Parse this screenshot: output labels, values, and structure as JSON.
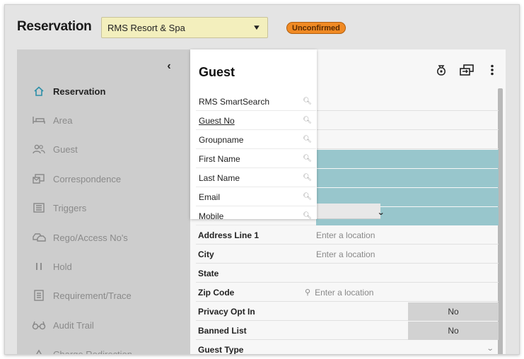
{
  "header": {
    "title": "Reservation",
    "property": "RMS Resort & Spa",
    "status": "Unconfirmed"
  },
  "sidebar": {
    "items": [
      {
        "label": "Reservation",
        "icon": "home-icon",
        "active": true
      },
      {
        "label": "Area",
        "icon": "bed-icon",
        "active": false
      },
      {
        "label": "Guest",
        "icon": "people-icon",
        "active": false
      },
      {
        "label": "Correspondence",
        "icon": "mail-icon",
        "active": false
      },
      {
        "label": "Triggers",
        "icon": "list-icon",
        "active": false
      },
      {
        "label": "Rego/Access No's",
        "icon": "car-icon",
        "active": false
      },
      {
        "label": "Hold",
        "icon": "pause-icon",
        "active": false
      },
      {
        "label": "Requirement/Trace",
        "icon": "note-icon",
        "active": false
      },
      {
        "label": "Audit Trail",
        "icon": "glasses-icon",
        "active": false
      },
      {
        "label": "Charge Redirection",
        "icon": "redirect-icon",
        "active": false
      }
    ]
  },
  "guest_popover": {
    "title": "Guest",
    "items": [
      {
        "label": "RMS SmartSearch"
      },
      {
        "label": "Guest No"
      },
      {
        "label": "Groupname"
      },
      {
        "label": "First Name"
      },
      {
        "label": "Last Name"
      },
      {
        "label": "Email"
      },
      {
        "label": "Mobile"
      }
    ]
  },
  "form": {
    "address_line_1": {
      "label": "Address Line 1",
      "placeholder": "Enter a location"
    },
    "city": {
      "label": "City",
      "placeholder": "Enter a location"
    },
    "state": {
      "label": "State"
    },
    "zip": {
      "label": "Zip Code",
      "placeholder": "Enter a location"
    },
    "privacy": {
      "label": "Privacy Opt In",
      "value": "No"
    },
    "banned": {
      "label": "Banned List",
      "value": "No"
    },
    "guest_type": {
      "label": "Guest Type"
    }
  },
  "colors": {
    "status_badge": "#f08a24",
    "property_select": "#f3efbd",
    "teal_fields": "#98c6cc",
    "active_icon": "#2d8fa8"
  }
}
